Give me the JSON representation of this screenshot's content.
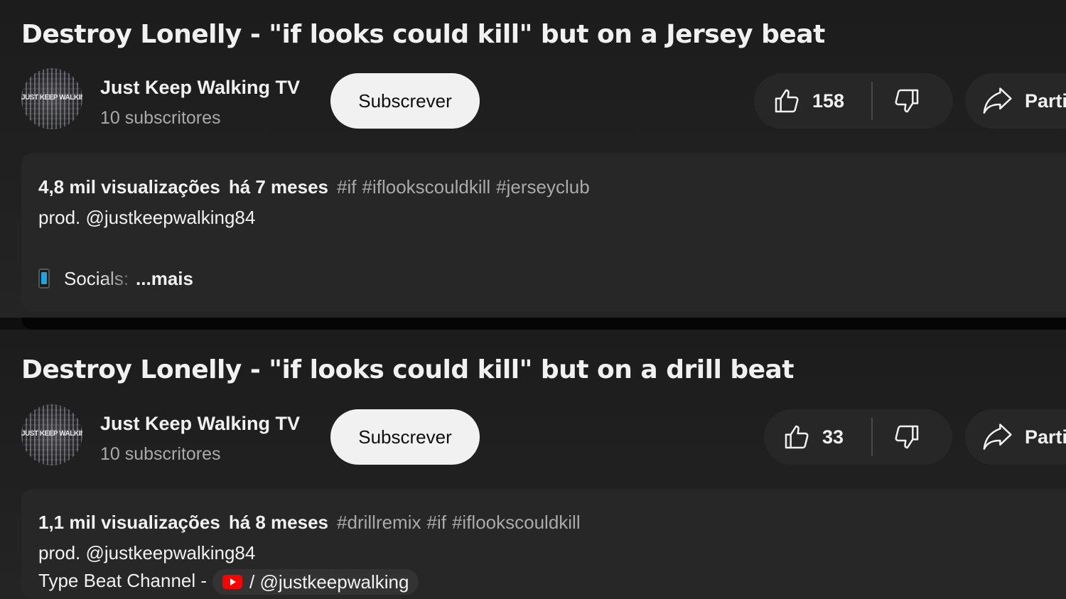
{
  "videos": [
    {
      "title": "Destroy Lonelly - \"if looks could kill\" but on a Jersey beat",
      "channel_name": "Just Keep Walking TV",
      "avatar_text": "JUST KEEP WALKING",
      "subscribers": "10 subscritores",
      "subscribe_label": "Subscrever",
      "likes": "158",
      "share_label": "Partilhar",
      "views": "4,8 mil visualizações",
      "age": "há 7 meses",
      "hashtags": [
        "#if",
        "#iflookscouldkill",
        "#jerseyclub"
      ],
      "desc_line1": "prod. @justkeepwalking84",
      "socials_label": "Socials:",
      "more_label": "...mais"
    },
    {
      "title": "Destroy Lonelly - \"if looks could kill\" but on a drill beat",
      "channel_name": "Just Keep Walking TV",
      "avatar_text": "JUST KEEP WALKING",
      "subscribers": "10 subscritores",
      "subscribe_label": "Subscrever",
      "likes": "33",
      "share_label": "Partilhar",
      "views": "1,1 mil visualizações",
      "age": "há 8 meses",
      "hashtags": [
        "#drillremix",
        "#if",
        "#iflookscouldkill"
      ],
      "desc_line1": "prod. @justkeepwalking84",
      "desc_line2": "Type Beat Channel -",
      "chip_label": "/ @justkeepwalking"
    }
  ],
  "icons": {
    "like": "thumbs-up-icon",
    "dislike": "thumbs-down-icon",
    "share": "share-arrow-icon",
    "phone": "mobile-phone-icon",
    "youtube": "youtube-logo-icon"
  },
  "colors": {
    "background": "#0f0f0f",
    "panel": "#272727",
    "text": "#f1f1f1",
    "secondary_text": "#aaaaaa",
    "subscribe_button": "#f1f1f1",
    "youtube_red": "#ff0000"
  }
}
